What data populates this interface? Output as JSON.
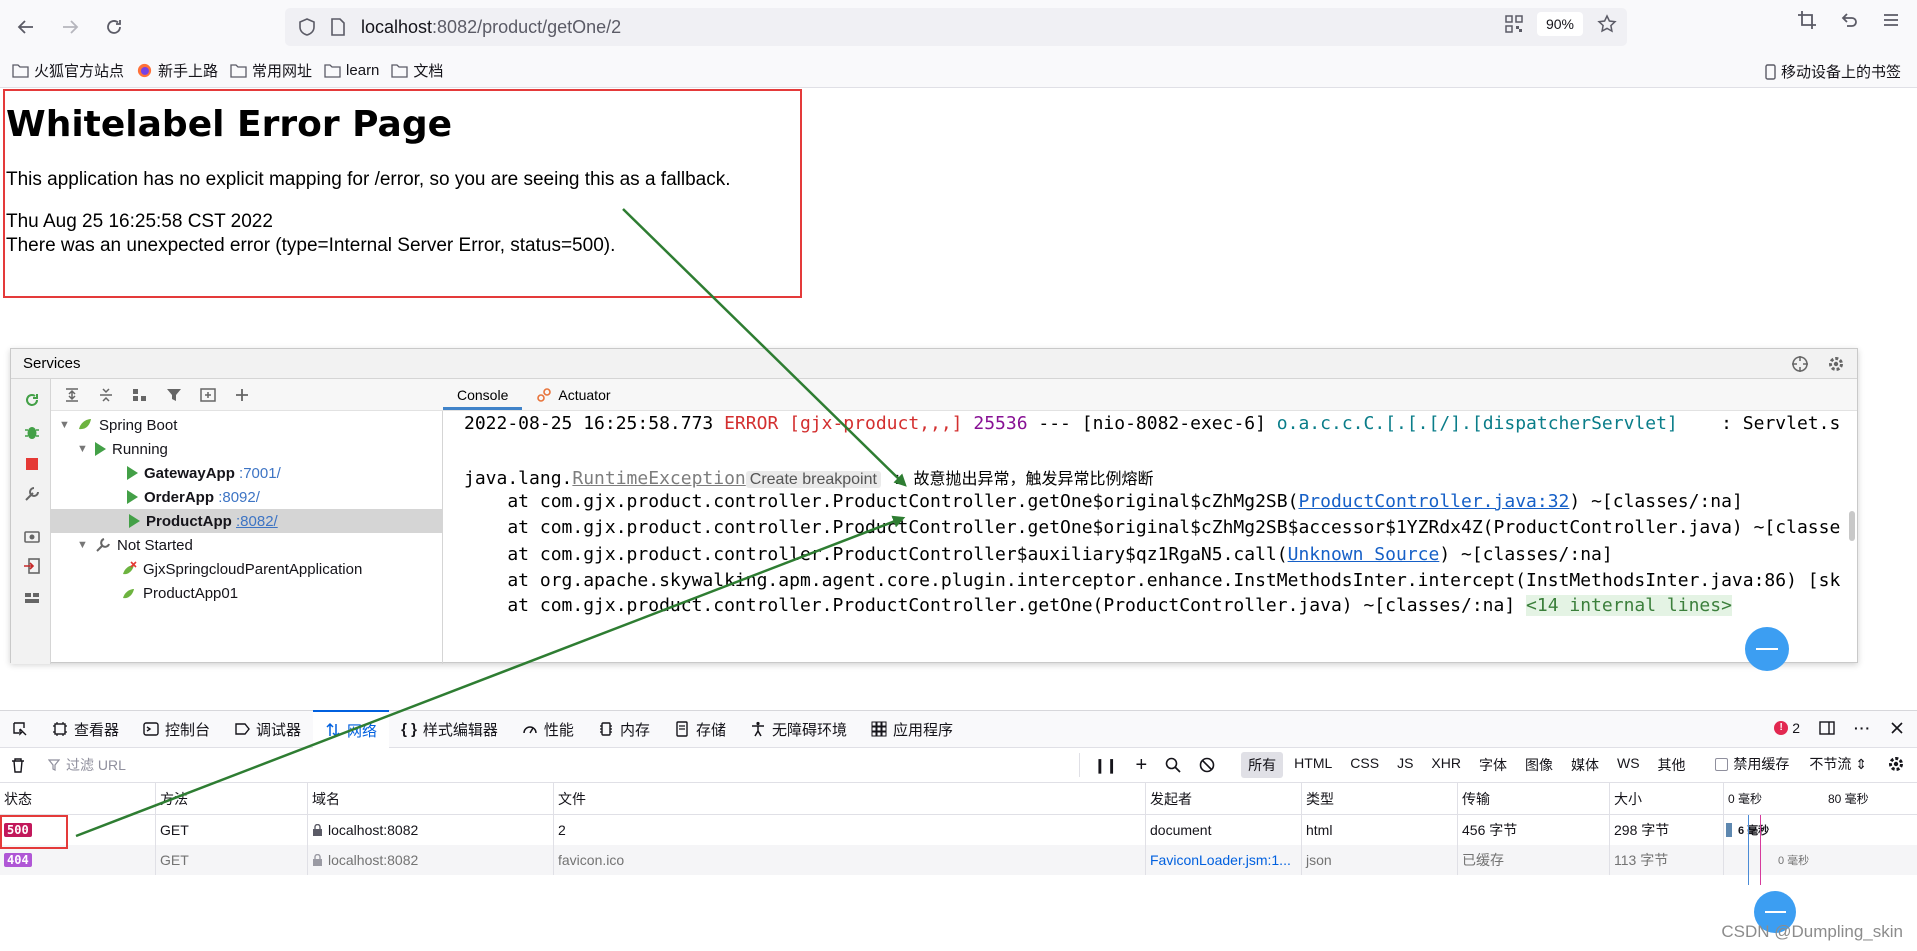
{
  "browser": {
    "url_host": "localhost",
    "url_path": ":8082/product/getOne/2",
    "zoom": "90%",
    "bookmarks": [
      "火狐官方站点",
      "新手上路",
      "常用网址",
      "learn",
      "文档"
    ],
    "mobile_bookmarks": "移动设备上的书签"
  },
  "error_page": {
    "title": "Whitelabel Error Page",
    "message": "This application has no explicit mapping for /error, so you are seeing this as a fallback.",
    "timestamp": "Thu Aug 25 16:25:58 CST 2022",
    "detail": "There was an unexpected error (type=Internal Server Error, status=500)."
  },
  "ide": {
    "panel_title": "Services",
    "tabs": [
      "Console",
      "Actuator"
    ],
    "tree": {
      "spring_boot": "Spring Boot",
      "running": "Running",
      "apps_running": [
        {
          "name": "GatewayApp",
          "port": ":7001/"
        },
        {
          "name": "OrderApp",
          "port": ":8092/"
        },
        {
          "name": "ProductApp",
          "port": ":8082/"
        }
      ],
      "not_started": "Not Started",
      "apps_stopped": [
        "GjxSpringcloudParentApplication",
        "ProductApp01"
      ]
    },
    "console": {
      "l1_time": "2022-08-25 16:25:58.773 ",
      "l1_level": "ERROR",
      "l1_ctx": " [gjx-product,,,] ",
      "l1_pid": "25536",
      "l1_rest": " --- [nio-8082-exec-6] ",
      "l1_logger": "o.a.c.c.C.[.[.[/].[dispatcherServlet]",
      "l1_tail": "    : Servlet.s",
      "l2_pre": "java.lang.",
      "l2_exc": "RuntimeException",
      "l2_bp": "Create breakpoint",
      "l2_colon": " : ",
      "l2_msg": "故意抛出异常，触发异常比例熔断",
      "l3_pre": "    at com.gjx.product.controller.ProductController.getOne$original$cZhMg2SB(",
      "l3_link": "ProductController.java:32",
      "l3_post": ") ~[classes/:na]",
      "l4": "    at com.gjx.product.controller.ProductController.getOne$original$cZhMg2SB$accessor$1YZRdx4Z(ProductController.java) ~[classe",
      "l5_pre": "    at com.gjx.product.controller.ProductController$auxiliary$qz1RgaN5.call(",
      "l5_link": "Unknown Source",
      "l5_post": ") ~[classes/:na]",
      "l6": "    at org.apache.skywalking.apm.agent.core.plugin.interceptor.enhance.InstMethodsInter.intercept(InstMethodsInter.java:86) [sk",
      "l7": "    at com.gjx.product.controller.ProductController.getOne(ProductController.java) ~[classes/:na] ",
      "l7_inline": "<14 internal lines>"
    }
  },
  "devtools": {
    "tabs": [
      "查看器",
      "控制台",
      "调试器",
      "网络",
      "样式编辑器",
      "性能",
      "内存",
      "存储",
      "无障碍环境",
      "应用程序"
    ],
    "error_count": "2",
    "filter_placeholder": "过滤 URL",
    "type_filters": [
      "所有",
      "HTML",
      "CSS",
      "JS",
      "XHR",
      "字体",
      "图像",
      "媒体",
      "WS",
      "其他"
    ],
    "disable_cache": "禁用缓存",
    "throttle": "不节流",
    "columns": [
      "状态",
      "方法",
      "域名",
      "文件",
      "发起者",
      "类型",
      "传输",
      "大小",
      "0 毫秒",
      "80 毫秒"
    ],
    "rows": [
      {
        "status": "500",
        "method": "GET",
        "domain": "localhost:8082",
        "file": "2",
        "initiator": "document",
        "type": "html",
        "transfer": "456 字节",
        "size": "298 字节",
        "timing": "6 毫秒"
      },
      {
        "status": "404",
        "method": "GET",
        "domain": "localhost:8082",
        "file": "favicon.ico",
        "initiator": "FaviconLoader.jsm:1...",
        "type": "json",
        "transfer": "已缓存",
        "size": "113 字节",
        "timing": "0 毫秒"
      }
    ]
  },
  "watermark": "CSDN @Dumpling_skin",
  "colors": {
    "annotation_red": "#e43a3a",
    "arrow_green": "#2e7d32",
    "status_500": "#c2185b",
    "status_404": "#b057d6"
  }
}
